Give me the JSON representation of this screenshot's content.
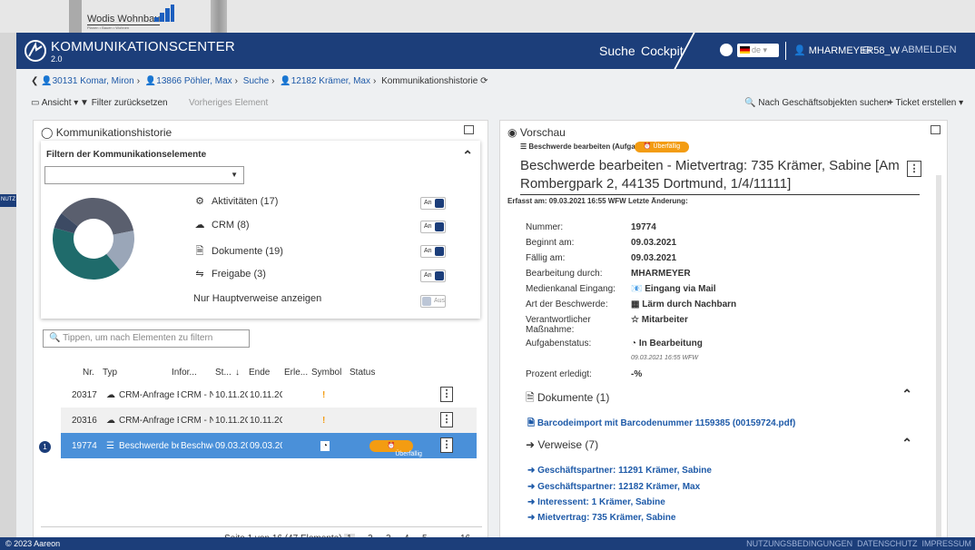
{
  "background": {
    "logo_name": "Wodis Wohnbau",
    "logo_sub": "Planen • Bauen • Wohnen",
    "left_stub": "NUTZ"
  },
  "topbar": {
    "title": "KOMMUNIKATIONSCENTER",
    "version": "2.0",
    "nav": [
      "Suche",
      "Cockpit"
    ],
    "lang": "de",
    "user": "MHARMEYER",
    "db": "58_W",
    "logout": "ABMELDEN"
  },
  "breadcrumb": {
    "items": [
      "30131 Komar, Miron",
      "13866 Pöhler, Max",
      "Suche",
      "12182 Krämer, Max"
    ],
    "current": "Kommunikationshistorie"
  },
  "toolbar": {
    "view": "Ansicht",
    "reset": "Filter zurücksetzen",
    "prev": "Vorheriges Element",
    "search_objects": "Nach Geschäftsobjekten suchen",
    "ticket": "Ticket erstellen"
  },
  "history": {
    "title": "Kommunikationshistorie",
    "filter_title": "Filtern der Kommunikationselemente",
    "filters": [
      {
        "label": "Aktivitäten (17)",
        "icon": "gear-icon",
        "toggle": "An"
      },
      {
        "label": "CRM (8)",
        "icon": "cloud-icon",
        "toggle": "An"
      },
      {
        "label": "Dokumente (19)",
        "icon": "document-icon",
        "toggle": "An"
      },
      {
        "label": "Freigabe (3)",
        "icon": "share-icon",
        "toggle": "An"
      }
    ],
    "main_refs_label": "Nur Hauptverweise anzeigen",
    "main_refs_toggle": "Aus",
    "donut": [
      {
        "label": "Aktivitäten",
        "value": 17,
        "color": "#5a5f6e"
      },
      {
        "label": "CRM",
        "value": 8,
        "color": "#9aa6b8"
      },
      {
        "label": "Dokumente",
        "value": 19,
        "color": "#1f6b6b"
      },
      {
        "label": "Freigabe",
        "value": 3,
        "color": "#3c4a63"
      }
    ],
    "search_placeholder": "Tippen, um nach Elementen zu filtern",
    "columns": [
      "Nr.",
      "Typ",
      "Infor...",
      "St...",
      "Ende",
      "Erle...",
      "Symbol",
      "Status"
    ],
    "rows": [
      {
        "nr": "20317",
        "typ": "CRM-Anfrage E",
        "info": "CRM - N",
        "start": "10.11.2C",
        "ende": "10.11.2C",
        "symbol": "!",
        "status": ""
      },
      {
        "nr": "20316",
        "typ": "CRM-Anfrage E",
        "info": "CRM - N",
        "start": "10.11.2C",
        "ende": "10.11.2C",
        "symbol": "!",
        "status": ""
      },
      {
        "nr": "19774",
        "typ": "Beschwerde be",
        "info": "Beschwe",
        "start": "09.03.20",
        "ende": "09.03.20",
        "symbol": "◔",
        "status": "Überfällig"
      }
    ],
    "row_badge": "1",
    "pager_text": "Seite 1 von 16 (47 Elemente)",
    "pages": [
      "1",
      "2",
      "3",
      "4",
      "5",
      "...",
      "16"
    ]
  },
  "preview": {
    "title": "Vorschau",
    "task_label": "Beschwerde bearbeiten (Aufgabe)",
    "overdue": "Überfällig",
    "heading": "Beschwerde bearbeiten - Mietvertrag: 735 Krämer, Sabine [Am Rombergpark 2, 44135 Dortmund, 1/4/11111]",
    "meta": "Erfasst am: 09.03.2021 16:55 WFW   Letzte Änderung:",
    "fields": [
      {
        "k": "Nummer:",
        "v": "19774"
      },
      {
        "k": "Beginnt am:",
        "v": "09.03.2021"
      },
      {
        "k": "Fällig am:",
        "v": "09.03.2021"
      },
      {
        "k": "Bearbeitung durch:",
        "v": "MHARMEYER"
      },
      {
        "k": "Medienkanal Eingang:",
        "v": "Eingang via Mail"
      },
      {
        "k": "Art der Beschwerde:",
        "v": "Lärm durch Nachbarn"
      },
      {
        "k": "Verantwortlicher Maßnahme:",
        "v": "Mitarbeiter"
      },
      {
        "k": "Aufgabenstatus:",
        "v": "In Bearbeitung"
      }
    ],
    "status_stamp": "09.03.2021 16:55 WFW",
    "percent_label": "Prozent erledigt:",
    "percent_value": "-%",
    "documents_title": "Dokumente (1)",
    "document_link": "Barcodeimport mit Barcodenummer 1159385 (00159724.pdf)",
    "refs_title": "Verweise (7)",
    "refs": [
      "Geschäftspartner: 11291 Krämer, Sabine",
      "Geschäftspartner: 12182 Krämer, Max",
      "Interessent: 1 Krämer, Sabine",
      "Mietvertrag: 735 Krämer, Sabine"
    ]
  },
  "footer": {
    "copyright": "© 2023 Aareon",
    "links": [
      "NUTZUNGSBEDINGUNGEN",
      "DATENSCHUTZ",
      "IMPRESSUM"
    ]
  }
}
